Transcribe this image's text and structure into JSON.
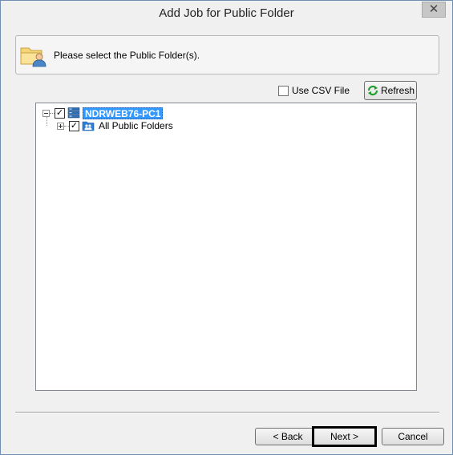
{
  "window": {
    "title": "Add Job for Public Folder",
    "close_glyph": "✕"
  },
  "header": {
    "instruction": "Please select the Public Folder(s).",
    "icon": "folder-user-icon"
  },
  "options": {
    "use_csv_label": "Use CSV File",
    "use_csv_checked": false,
    "refresh_label": "Refresh"
  },
  "tree": {
    "nodes": [
      {
        "label": "NDRWEB76-PC1",
        "checked": true,
        "expanded": true,
        "selected": true,
        "icon": "server-icon"
      },
      {
        "label": "All Public Folders",
        "checked": true,
        "expanded": false,
        "selected": false,
        "icon": "public-folder-icon"
      }
    ]
  },
  "footer": {
    "back_label": "< Back",
    "next_label": "Next >",
    "cancel_label": "Cancel"
  },
  "colors": {
    "selection": "#3399ff",
    "title_text": "#222222"
  }
}
